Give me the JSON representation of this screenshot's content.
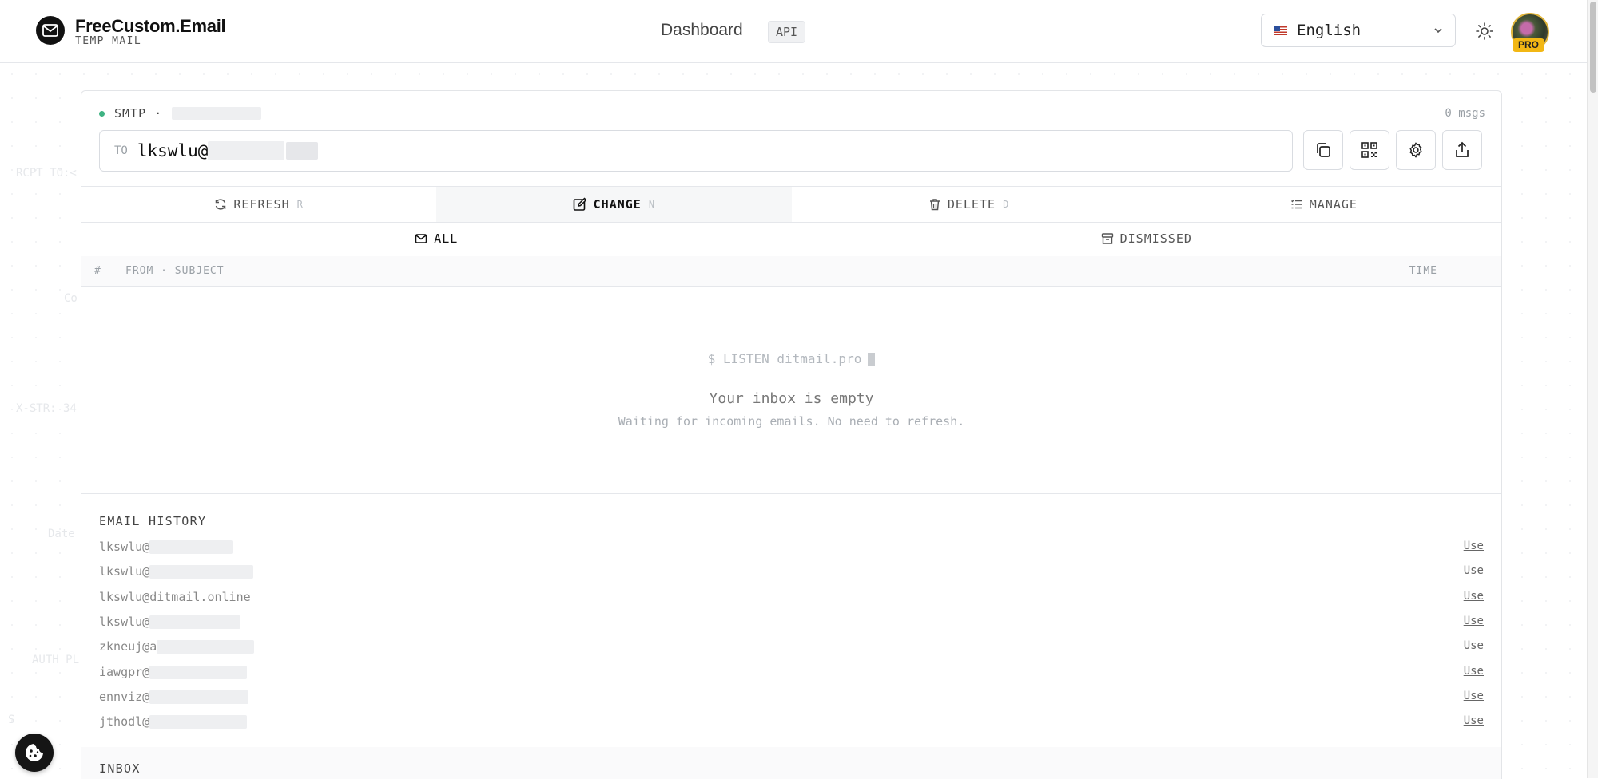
{
  "brand": {
    "name": "FreeCustom.Email",
    "subtitle": "TEMP MAIL"
  },
  "nav": {
    "dashboard": "Dashboard",
    "api": "API"
  },
  "language": {
    "selected": "English"
  },
  "avatar": {
    "badge": "PRO"
  },
  "background": {
    "labels": [
      "RCPT TO:<",
      "Co",
      "X-STR: 34",
      "Date",
      "AUTH PL",
      "S"
    ]
  },
  "mailbox": {
    "protocol": "SMTP ·",
    "message_count": "0 msgs",
    "to_label": "TO",
    "address": "lkswlu@"
  },
  "actions": [
    {
      "label": "REFRESH",
      "shortcut": "R",
      "icon": "refresh-icon"
    },
    {
      "label": "CHANGE",
      "shortcut": "N",
      "icon": "edit-icon"
    },
    {
      "label": "DELETE",
      "shortcut": "D",
      "icon": "trash-icon"
    },
    {
      "label": "MANAGE",
      "shortcut": "",
      "icon": "list-icon"
    }
  ],
  "tabs": [
    {
      "label": "ALL",
      "icon": "mail-icon"
    },
    {
      "label": "DISMISSED",
      "icon": "archive-icon"
    }
  ],
  "table": {
    "col_num": "#",
    "col_from": "FROM · SUBJECT",
    "col_time": "TIME"
  },
  "empty": {
    "listen": "$ LISTEN ditmail.pro",
    "title": "Your inbox is empty",
    "subtitle": "Waiting for incoming emails. No need to refresh."
  },
  "history": {
    "title": "EMAIL HISTORY",
    "use_label": "Use",
    "items": [
      "lkswlu@",
      "lkswlu@",
      "lkswlu@ditmail.online",
      "lkswlu@",
      "zkneuj@a",
      "iawgpr@",
      "ennviz@",
      "jthodl@"
    ]
  },
  "inbox": {
    "title": "INBOX"
  },
  "colors": {
    "live": "#3fb383",
    "pro": "#f2b714",
    "text": "#1f2328",
    "border": "#e5e7eb"
  }
}
